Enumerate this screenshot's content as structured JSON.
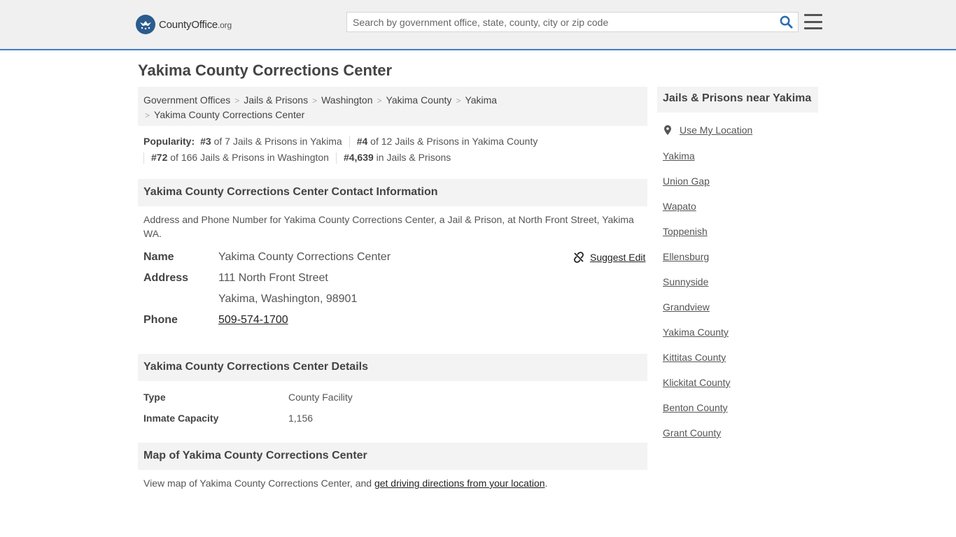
{
  "header": {
    "logo_main": "CountyOffice",
    "logo_suffix": ".org",
    "search_placeholder": "Search by government office, state, county, city or zip code"
  },
  "page": {
    "title": "Yakima County Corrections Center"
  },
  "breadcrumb": [
    "Government Offices",
    "Jails & Prisons",
    "Washington",
    "Yakima County",
    "Yakima",
    "Yakima County Corrections Center"
  ],
  "popularity": {
    "label": "Popularity:",
    "items": [
      {
        "rank": "#3",
        "text": " of 7 Jails & Prisons in Yakima"
      },
      {
        "rank": "#4",
        "text": " of 12 Jails & Prisons in Yakima County"
      },
      {
        "rank": "#72",
        "text": " of 166 Jails & Prisons in Washington"
      },
      {
        "rank": "#4,639",
        "text": " in Jails & Prisons"
      }
    ]
  },
  "contact": {
    "heading": "Yakima County Corrections Center Contact Information",
    "description": "Address and Phone Number for Yakima County Corrections Center, a Jail & Prison, at North Front Street, Yakima WA.",
    "name_label": "Name",
    "name_value": "Yakima County Corrections Center",
    "address_label": "Address",
    "address_line1": "111 North Front Street",
    "address_line2": "Yakima, Washington, 98901",
    "phone_label": "Phone",
    "phone_value": "509-574-1700",
    "suggest_edit": "Suggest Edit"
  },
  "details": {
    "heading": "Yakima County Corrections Center Details",
    "type_label": "Type",
    "type_value": "County Facility",
    "capacity_label": "Inmate Capacity",
    "capacity_value": "1,156"
  },
  "map": {
    "heading": "Map of Yakima County Corrections Center",
    "desc_prefix": "View map of Yakima County Corrections Center, and ",
    "desc_link": "get driving directions from your location",
    "desc_suffix": "."
  },
  "sidebar": {
    "heading": "Jails & Prisons near Yakima",
    "use_location": "Use My Location",
    "links": [
      "Yakima",
      "Union Gap",
      "Wapato",
      "Toppenish",
      "Ellensburg",
      "Sunnyside",
      "Grandview",
      "Yakima County",
      "Kittitas County",
      "Klickitat County",
      "Benton County",
      "Grant County"
    ]
  },
  "colors": {
    "brand_blue": "#2b5c8e",
    "accent_line": "#3f7fbf",
    "panel_bg": "#f3f3f3"
  }
}
